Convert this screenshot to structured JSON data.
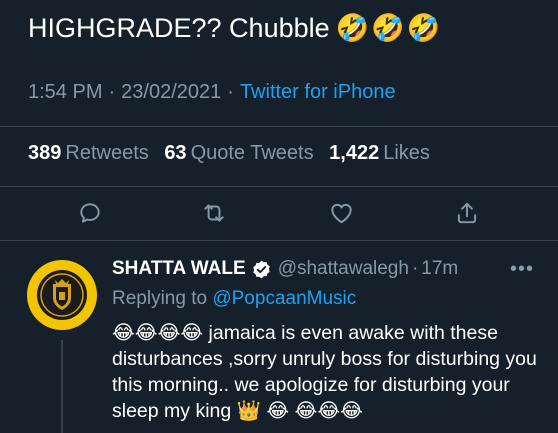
{
  "tweet": {
    "text": "HIGHGRADE?? Chubble",
    "text_emojis": "🤣🤣🤣",
    "time": "1:54 PM",
    "date": "23/02/2021",
    "source": "Twitter for iPhone",
    "retweets_count": "389",
    "retweets_label": "Retweets",
    "quote_count": "63",
    "quote_label": "Quote Tweets",
    "likes_count": "1,422",
    "likes_label": "Likes"
  },
  "actions": {
    "reply_icon": "comment-icon",
    "retweet_icon": "retweet-icon",
    "like_icon": "heart-icon",
    "share_icon": "share-icon"
  },
  "reply": {
    "name": "SHATTA WALE",
    "handle": "@shattawalegh",
    "separator": "·",
    "time": "17m",
    "replying_prefix": "Replying to",
    "replying_to": "@PopcaanMusic",
    "body": "😂😂😂😂 jamaica is even awake with these  disturbances ,sorry unruly boss for disturbing you this morning.. we apologize for disturbing your sleep my king 👑 😂 😂😂😂"
  },
  "colors": {
    "background": "#15202b",
    "accent": "#1da1f2",
    "muted": "#8899a6",
    "divider": "#38444d",
    "avatar_bg": "#f3c400"
  }
}
